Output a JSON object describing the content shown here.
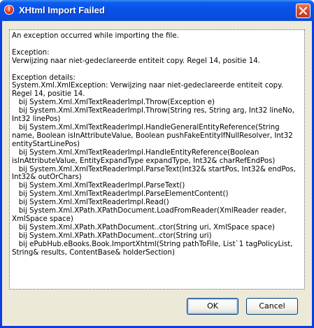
{
  "window": {
    "title": "XHtml Import Failed",
    "title_icon_glyph": "!",
    "colors": {
      "titlebar": "#0a52e8",
      "close_button": "#d6452a",
      "client_bg": "#ece9d8"
    }
  },
  "message": {
    "text": "An exception occurred while importing the file.\n\nException:\nVerwijzing naar niet-gedeclareerde entiteit copy. Regel 14, positie 14.\n\nException details:\nSystem.Xml.XmlException: Verwijzing naar niet-gedeclareerde entiteit copy. Regel 14, positie 14.\n   bij System.Xml.XmlTextReaderImpl.Throw(Exception e)\n   bij System.Xml.XmlTextReaderImpl.Throw(String res, String arg, Int32 lineNo, Int32 linePos)\n   bij System.Xml.XmlTextReaderImpl.HandleGeneralEntityReference(String name, Boolean isInAttributeValue, Boolean pushFakeEntityIfNullResolver, Int32 entityStartLinePos)\n   bij System.Xml.XmlTextReaderImpl.HandleEntityReference(Boolean isInAttributeValue, EntityExpandType expandType, Int32& charRefEndPos)\n   bij System.Xml.XmlTextReaderImpl.ParseText(Int32& startPos, Int32& endPos, Int32& outOrChars)\n   bij System.Xml.XmlTextReaderImpl.ParseText()\n   bij System.Xml.XmlTextReaderImpl.ParseElementContent()\n   bij System.Xml.XmlTextReaderImpl.Read()\n   bij System.Xml.XPath.XPathDocument.LoadFromReader(XmlReader reader, XmlSpace space)\n   bij System.Xml.XPath.XPathDocument..ctor(String uri, XmlSpace space)\n   bij System.Xml.XPath.XPathDocument..ctor(String uri)\n   bij ePubHub.eBooks.Book.ImportXhtml(String pathToFile, List`1 tagPolicyList, String& results, ContentBase& holderSection)"
  },
  "buttons": {
    "ok_label": "OK",
    "cancel_label": "Cancel"
  },
  "icons": {
    "title": "error-icon",
    "close": "close-icon"
  }
}
